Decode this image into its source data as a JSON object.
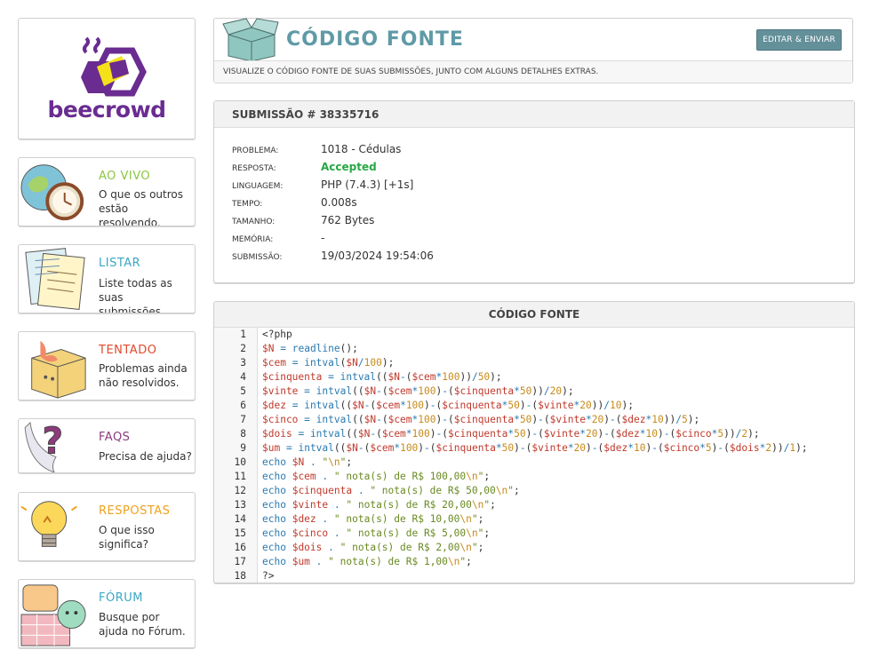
{
  "brand": {
    "name": "beecrowd"
  },
  "sidebar": {
    "cards": [
      {
        "title": "AO VIVO",
        "desc": "O que os outros estão resolvendo.",
        "color": "#8cc63f",
        "icon": "globe-clock-icon"
      },
      {
        "title": "LISTAR",
        "desc": "Liste todas as suas submissões.",
        "color": "#3aa7c4",
        "icon": "papers-icon"
      },
      {
        "title": "TENTADO",
        "desc": "Problemas ainda não resolvidos.",
        "color": "#e04a2d",
        "icon": "box-icon"
      },
      {
        "title": "FAQS",
        "desc": "Precisa de ajuda?",
        "color": "#8e3a7d",
        "icon": "question-icon"
      },
      {
        "title": "RESPOSTAS",
        "desc": "O que isso significa?",
        "color": "#f0a11b",
        "icon": "lightbulb-icon"
      },
      {
        "title": "FÓRUM",
        "desc": "Busque por ajuda no Fórum.",
        "color": "#3aa7c4",
        "icon": "forum-icon"
      }
    ]
  },
  "header": {
    "title": "CÓDIGO FONTE",
    "edit_button": "EDITAR & ENVIAR",
    "subtitle": "VISUALIZE O CÓDIGO FONTE DE SUAS SUBMISSÕES, JUNTO COM ALGUNS DETALHES EXTRAS."
  },
  "submission": {
    "heading": "SUBMISSÃO # 38335716",
    "fields": [
      {
        "label": "PROBLEMA:",
        "value": "1018 - Cédulas"
      },
      {
        "label": "RESPOSTA:",
        "value": "Accepted"
      },
      {
        "label": "LINGUAGEM:",
        "value": "PHP (7.4.3) [+1s]"
      },
      {
        "label": "TEMPO:",
        "value": "0.008s"
      },
      {
        "label": "TAMANHO:",
        "value": "762 Bytes"
      },
      {
        "label": "MEMÓRIA:",
        "value": "-"
      },
      {
        "label": "SUBMISSÃO:",
        "value": "19/03/2024 19:54:06"
      }
    ]
  },
  "code": {
    "heading": "CÓDIGO FONTE",
    "lines": [
      "<?php",
      "$N = readline();",
      "$cem = intval($N/100);",
      "$cinquenta = intval(($N-($cem*100))/50);",
      "$vinte = intval(($N-($cem*100)-($cinquenta*50))/20);",
      "$dez = intval(($N-($cem*100)-($cinquenta*50)-($vinte*20))/10);",
      "$cinco = intval(($N-($cem*100)-($cinquenta*50)-($vinte*20)-($dez*10))/5);",
      "$dois = intval(($N-($cem*100)-($cinquenta*50)-($vinte*20)-($dez*10)-($cinco*5))/2);",
      "$um = intval(($N-($cem*100)-($cinquenta*50)-($vinte*20)-($dez*10)-($cinco*5)-($dois*2))/1);",
      "echo $N . \"\\n\";",
      "echo $cem . \" nota(s) de R$ 100,00\\n\";",
      "echo $cinquenta . \" nota(s) de R$ 50,00\\n\";",
      "echo $vinte . \" nota(s) de R$ 20,00\\n\";",
      "echo $dez . \" nota(s) de R$ 10,00\\n\";",
      "echo $cinco . \" nota(s) de R$ 5,00\\n\";",
      "echo $dois . \" nota(s) de R$ 2,00\\n\";",
      "echo $um . \" nota(s) de R$ 1,00\\n\";",
      "?>"
    ]
  }
}
